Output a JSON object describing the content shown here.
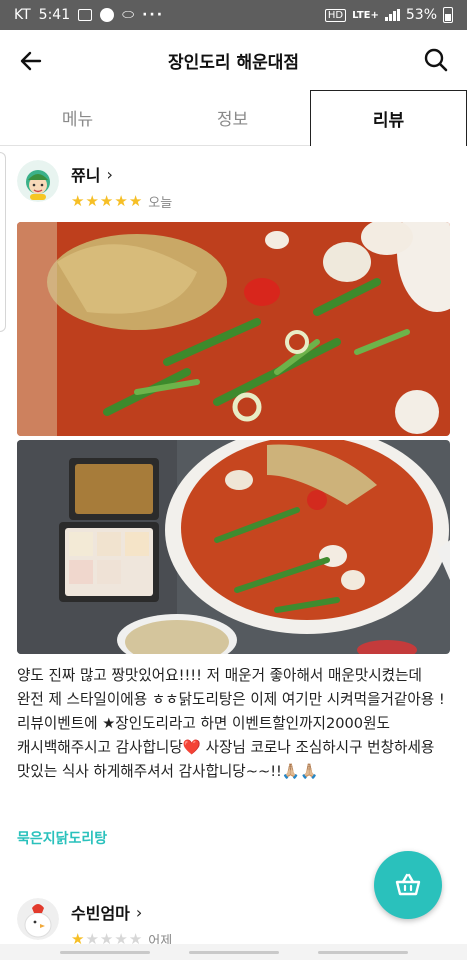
{
  "status_bar": {
    "carrier": "KT",
    "time": "5:41",
    "network": "LTE+",
    "battery": "53%"
  },
  "header": {
    "title": "장인도리 해운대점"
  },
  "tabs": [
    {
      "label": "메뉴"
    },
    {
      "label": "정보"
    },
    {
      "label": "리뷰"
    }
  ],
  "reviews": [
    {
      "author": "쮸니",
      "rating": 5,
      "date": "오늘",
      "text": "양도 진짜 많고 짱맛있어요!!!! 저 매운거 좋아해서 매운맛시켰는데 완전 제 스타일이에용 ㅎㅎ닭도리탕은 이제 여기만 시켜먹을거같아용 ! 리뷰이벤트에 ★장인도리라고 하면 이벤트할인까지2000원도 캐시백해주시고 감사합니당❤️ 사장님 코로나 조심하시구 번창하세용 맛있는 식사 하게해주셔서 감사합니당~~!!🙏🏼🙏🏼",
      "menu_tag": "묵은지닭도리탕"
    },
    {
      "author": "수빈엄마",
      "rating": 1,
      "date": "어제"
    }
  ],
  "colors": {
    "accent": "#2ac1bc",
    "star": "#f6bf26",
    "status_bar": "#5e5e5e"
  },
  "icons": {
    "back": "arrow-left-icon",
    "search": "search-icon",
    "cart": "basket-icon"
  }
}
